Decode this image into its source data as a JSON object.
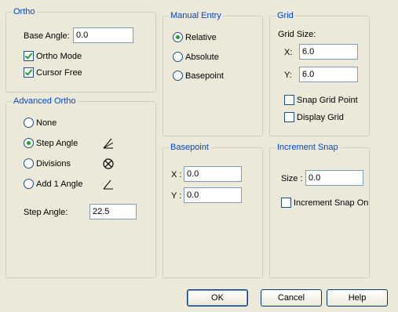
{
  "ortho": {
    "title": "Ortho",
    "base_angle_label": "Base Angle:",
    "base_angle_value": "0.0",
    "ortho_mode_label": "Ortho Mode",
    "ortho_mode_checked": true,
    "cursor_free_label": "Cursor Free",
    "cursor_free_checked": true
  },
  "advanced_ortho": {
    "title": "Advanced Ortho",
    "options": [
      {
        "label": "None",
        "selected": false,
        "icon": "none"
      },
      {
        "label": "Step Angle",
        "selected": true,
        "icon": "step-angle-icon"
      },
      {
        "label": "Divisions",
        "selected": false,
        "icon": "divisions-icon"
      },
      {
        "label": "Add 1 Angle",
        "selected": false,
        "icon": "add-angle-icon"
      }
    ],
    "step_angle_label": "Step Angle:",
    "step_angle_value": "22.5"
  },
  "manual_entry": {
    "title": "Manual Entry",
    "options": [
      {
        "label": "Relative",
        "selected": true
      },
      {
        "label": "Absolute",
        "selected": false
      },
      {
        "label": "Basepoint",
        "selected": false
      }
    ]
  },
  "basepoint": {
    "title": "Basepoint",
    "x_label": "X :",
    "x_value": "0.0",
    "y_label": "Y :",
    "y_value": "0.0"
  },
  "grid": {
    "title": "Grid",
    "grid_size_label": "Grid Size:",
    "x_label": "X:",
    "x_value": "6.0",
    "y_label": "Y:",
    "y_value": "6.0",
    "snap_grid_point_label": "Snap Grid Point",
    "snap_grid_point_checked": false,
    "display_grid_label": "Display Grid",
    "display_grid_checked": false
  },
  "increment_snap": {
    "title": "Increment Snap",
    "size_label": "Size :",
    "size_value": "0.0",
    "increment_snap_on_label": "Increment Snap On",
    "increment_snap_on_checked": false
  },
  "buttons": {
    "ok": "OK",
    "cancel": "Cancel",
    "help": "Help"
  },
  "colors": {
    "group_title": "#0046d5",
    "dialog_bg": "#ece9d8",
    "check_mark": "#21a121"
  }
}
